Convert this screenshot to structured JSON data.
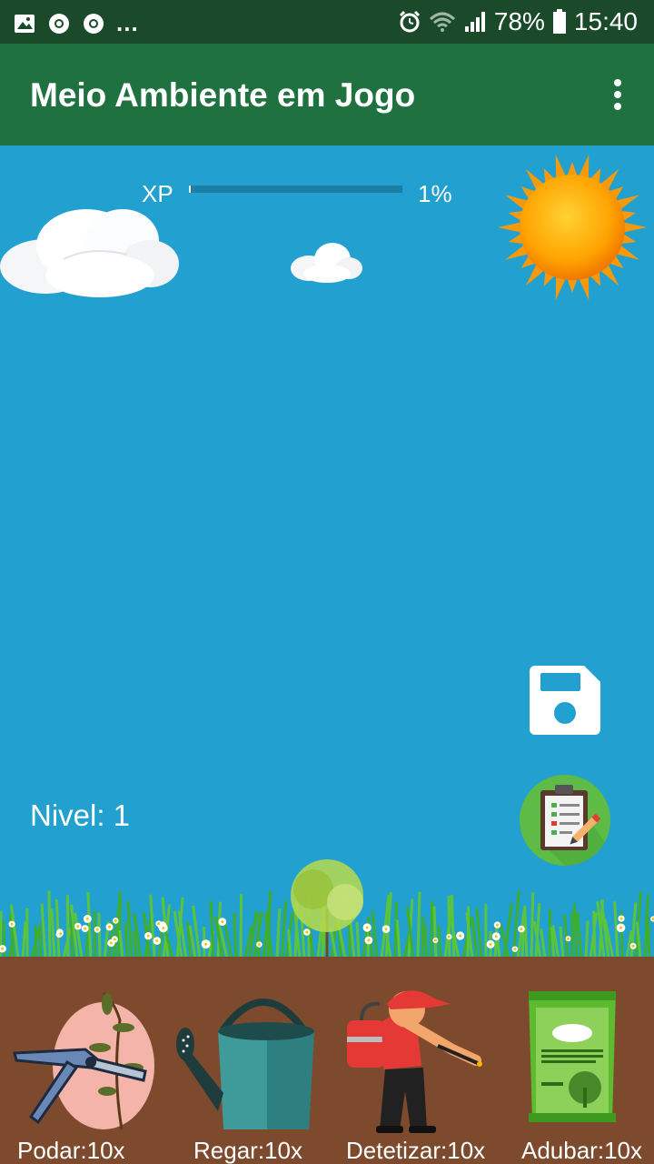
{
  "status_bar": {
    "battery": "78%",
    "time": "15:40",
    "more": "...",
    "icons": [
      "gallery-icon",
      "chrome-icon",
      "chrome-icon",
      "alarm-icon",
      "wifi-icon",
      "signal-icon",
      "battery-icon"
    ]
  },
  "app_bar": {
    "title": "Meio Ambiente em Jogo",
    "menu_icon": "overflow-menu-icon"
  },
  "game": {
    "xp_label": "XP",
    "xp_percent": "1%",
    "xp_progress": 0.01,
    "level_text": "Nivel:  1",
    "save_icon": "save-icon",
    "tasks_icon": "clipboard-icon"
  },
  "tools": [
    {
      "label": "Podar:10x",
      "icon": "pruning-shears-icon"
    },
    {
      "label": "Regar:10x",
      "icon": "watering-can-icon"
    },
    {
      "label": "Detetizar:10x",
      "icon": "pest-sprayer-icon"
    },
    {
      "label": "Adubar:10x",
      "icon": "fertilizer-bag-icon"
    }
  ],
  "colors": {
    "sky": "#22a0cf",
    "app_bar": "#1f7240",
    "status_bar": "#1a4a2a",
    "soil": "#7d4a2e"
  }
}
